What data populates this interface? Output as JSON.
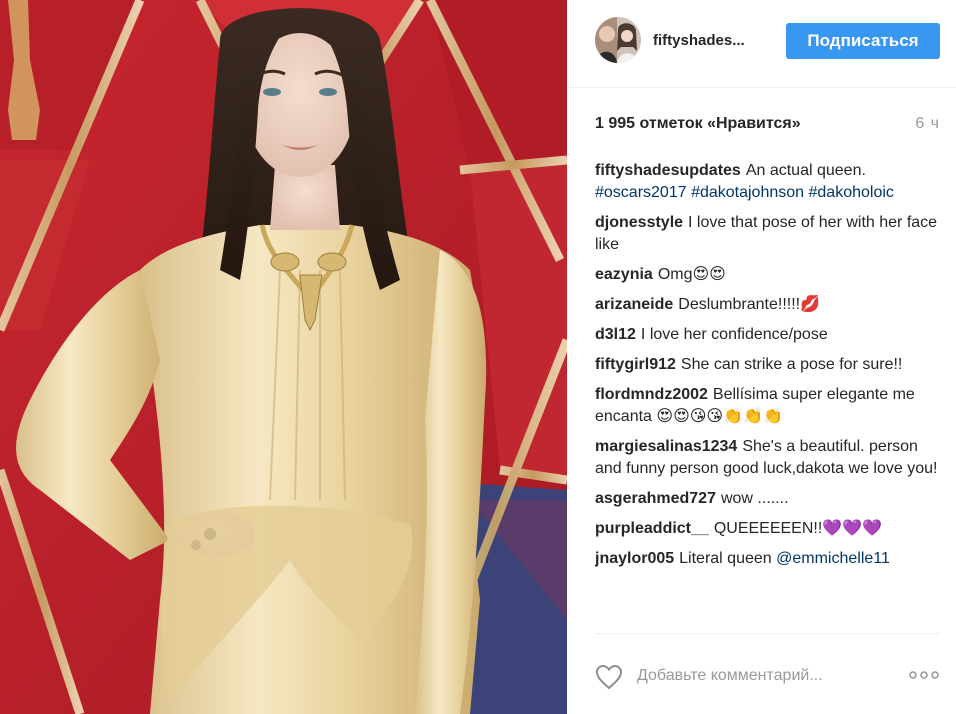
{
  "post": {
    "image_icon": "photo-of-woman-in-gold-gown",
    "account": {
      "username": "fiftyshades...",
      "follow_label": "Подписаться",
      "avatar_icon": "avatar-photo"
    },
    "likes_text": "1 995 отметок «Нравится»",
    "time_ago": "6 ч",
    "caption": {
      "user": "fiftyshadesupdates",
      "text": "An actual queen.",
      "hashtags": "#oscars2017 #dakotajohnson #dakoholoic"
    },
    "comments": [
      {
        "user": "djonesstyle",
        "text": "I love that pose of her with her face like"
      },
      {
        "user": "eazynia",
        "text": "Omg😍😍"
      },
      {
        "user": "arizaneide",
        "text": "Deslumbrante!!!!!💋"
      },
      {
        "user": "d3l12",
        "text": "I love her confidence/pose"
      },
      {
        "user": "fiftygirl912",
        "text": "She can strike a pose for sure!!"
      },
      {
        "user": "flordmndz2002",
        "text": "Bellísima super elegante me encanta 😍😍😘😘👏👏👏"
      },
      {
        "user": "margiesalinas1234",
        "text": "She's a beautiful. person and funny person good luck,dakota we love you!"
      },
      {
        "user": "asgerahmed727",
        "text": "wow ......."
      },
      {
        "user": "purpleaddict__",
        "text": "QUEEEEEEN!!💜💜💜"
      },
      {
        "user": "jnaylor005",
        "text": "Literal queen",
        "mention": "@emmichelle11"
      }
    ],
    "comment_placeholder": "Добавьте комментарий...",
    "icons": {
      "like": "heart-outline-icon",
      "more": "more-options-icon"
    },
    "colors": {
      "follow_button": "#3897f0",
      "hashtag": "#003569",
      "muted": "#999999"
    }
  }
}
